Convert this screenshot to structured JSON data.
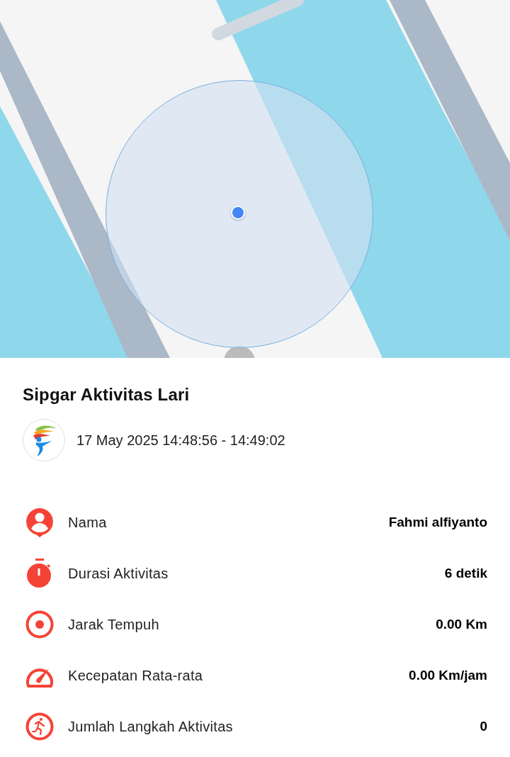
{
  "title": "Sipgar Aktivitas Lari",
  "time_range": "17 May 2025 14:48:56 - 14:49:02",
  "stats": [
    {
      "label": "Nama",
      "value": "Fahmi alfiyanto"
    },
    {
      "label": "Durasi Aktivitas",
      "value": "6 detik"
    },
    {
      "label": "Jarak Tempuh",
      "value": "0.00 Km"
    },
    {
      "label": "Kecepatan Rata-rata",
      "value": "0.00 Km/jam"
    },
    {
      "label": "Jumlah Langkah Aktivitas",
      "value": "0"
    }
  ]
}
